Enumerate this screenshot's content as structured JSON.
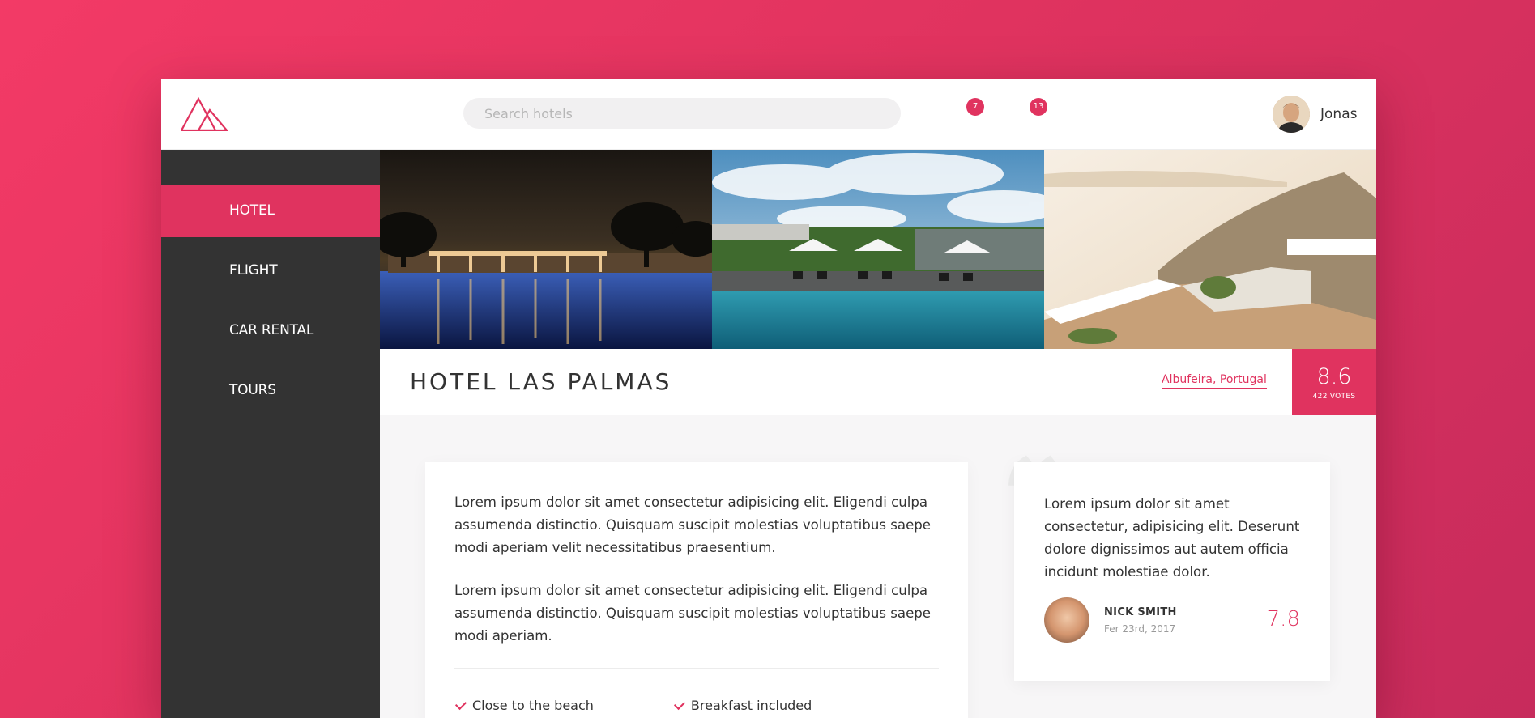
{
  "header": {
    "search_placeholder": "Search hotels",
    "bookmarks_badge": "7",
    "chat_badge": "13",
    "user_name": "Jonas"
  },
  "sidebar": {
    "items": [
      {
        "label": "HOTEL",
        "active": true
      },
      {
        "label": "FLIGHT",
        "active": false
      },
      {
        "label": "CAR RENTAL",
        "active": false
      },
      {
        "label": "TOURS",
        "active": false
      }
    ]
  },
  "hotel": {
    "name": "HOTEL LAS PALMAS",
    "location": "Albufeira, Portugal",
    "rating": "8.6",
    "votes": "422 VOTES"
  },
  "description": {
    "paragraphs": [
      "Lorem ipsum dolor sit amet consectetur adipisicing elit. Eligendi culpa assumenda distinctio. Quisquam suscipit molestias voluptatibus saepe modi aperiam velit necessitatibus praesentium.",
      "Lorem ipsum dolor sit amet consectetur adipisicing elit. Eligendi culpa assumenda distinctio. Quisquam suscipit molestias voluptatibus saepe modi aperiam."
    ],
    "features": [
      "Close to the beach",
      "Breakfast included"
    ]
  },
  "review": {
    "text": "Lorem ipsum dolor sit amet consectetur, adipisicing elit. Deserunt dolore dignissimos aut autem officia incidunt molestiae dolor.",
    "name": "NICK SMITH",
    "date": "Fer 23rd, 2017",
    "score": "7.8"
  },
  "colors": {
    "accent": "#e0335f",
    "sidebar": "#333333",
    "background": "#f7f6f7"
  },
  "icons": [
    "logo-icon",
    "bookmark-icon",
    "chat-icon",
    "quote-icon"
  ]
}
